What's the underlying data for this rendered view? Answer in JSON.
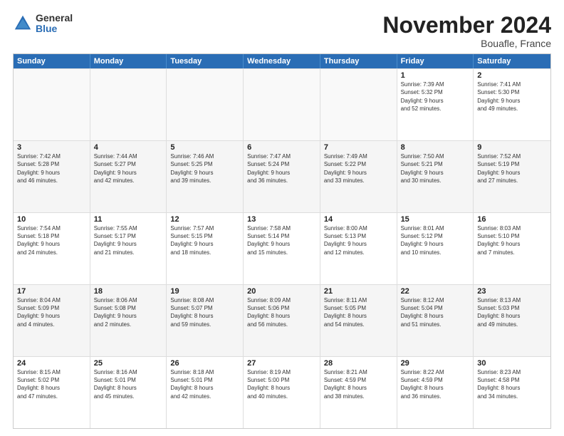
{
  "logo": {
    "general": "General",
    "blue": "Blue"
  },
  "header": {
    "month": "November 2024",
    "location": "Bouafle, France"
  },
  "days": [
    "Sunday",
    "Monday",
    "Tuesday",
    "Wednesday",
    "Thursday",
    "Friday",
    "Saturday"
  ],
  "weeks": [
    [
      {
        "day": "",
        "info": ""
      },
      {
        "day": "",
        "info": ""
      },
      {
        "day": "",
        "info": ""
      },
      {
        "day": "",
        "info": ""
      },
      {
        "day": "",
        "info": ""
      },
      {
        "day": "1",
        "info": "Sunrise: 7:39 AM\nSunset: 5:32 PM\nDaylight: 9 hours\nand 52 minutes."
      },
      {
        "day": "2",
        "info": "Sunrise: 7:41 AM\nSunset: 5:30 PM\nDaylight: 9 hours\nand 49 minutes."
      }
    ],
    [
      {
        "day": "3",
        "info": "Sunrise: 7:42 AM\nSunset: 5:28 PM\nDaylight: 9 hours\nand 46 minutes."
      },
      {
        "day": "4",
        "info": "Sunrise: 7:44 AM\nSunset: 5:27 PM\nDaylight: 9 hours\nand 42 minutes."
      },
      {
        "day": "5",
        "info": "Sunrise: 7:46 AM\nSunset: 5:25 PM\nDaylight: 9 hours\nand 39 minutes."
      },
      {
        "day": "6",
        "info": "Sunrise: 7:47 AM\nSunset: 5:24 PM\nDaylight: 9 hours\nand 36 minutes."
      },
      {
        "day": "7",
        "info": "Sunrise: 7:49 AM\nSunset: 5:22 PM\nDaylight: 9 hours\nand 33 minutes."
      },
      {
        "day": "8",
        "info": "Sunrise: 7:50 AM\nSunset: 5:21 PM\nDaylight: 9 hours\nand 30 minutes."
      },
      {
        "day": "9",
        "info": "Sunrise: 7:52 AM\nSunset: 5:19 PM\nDaylight: 9 hours\nand 27 minutes."
      }
    ],
    [
      {
        "day": "10",
        "info": "Sunrise: 7:54 AM\nSunset: 5:18 PM\nDaylight: 9 hours\nand 24 minutes."
      },
      {
        "day": "11",
        "info": "Sunrise: 7:55 AM\nSunset: 5:17 PM\nDaylight: 9 hours\nand 21 minutes."
      },
      {
        "day": "12",
        "info": "Sunrise: 7:57 AM\nSunset: 5:15 PM\nDaylight: 9 hours\nand 18 minutes."
      },
      {
        "day": "13",
        "info": "Sunrise: 7:58 AM\nSunset: 5:14 PM\nDaylight: 9 hours\nand 15 minutes."
      },
      {
        "day": "14",
        "info": "Sunrise: 8:00 AM\nSunset: 5:13 PM\nDaylight: 9 hours\nand 12 minutes."
      },
      {
        "day": "15",
        "info": "Sunrise: 8:01 AM\nSunset: 5:12 PM\nDaylight: 9 hours\nand 10 minutes."
      },
      {
        "day": "16",
        "info": "Sunrise: 8:03 AM\nSunset: 5:10 PM\nDaylight: 9 hours\nand 7 minutes."
      }
    ],
    [
      {
        "day": "17",
        "info": "Sunrise: 8:04 AM\nSunset: 5:09 PM\nDaylight: 9 hours\nand 4 minutes."
      },
      {
        "day": "18",
        "info": "Sunrise: 8:06 AM\nSunset: 5:08 PM\nDaylight: 9 hours\nand 2 minutes."
      },
      {
        "day": "19",
        "info": "Sunrise: 8:08 AM\nSunset: 5:07 PM\nDaylight: 8 hours\nand 59 minutes."
      },
      {
        "day": "20",
        "info": "Sunrise: 8:09 AM\nSunset: 5:06 PM\nDaylight: 8 hours\nand 56 minutes."
      },
      {
        "day": "21",
        "info": "Sunrise: 8:11 AM\nSunset: 5:05 PM\nDaylight: 8 hours\nand 54 minutes."
      },
      {
        "day": "22",
        "info": "Sunrise: 8:12 AM\nSunset: 5:04 PM\nDaylight: 8 hours\nand 51 minutes."
      },
      {
        "day": "23",
        "info": "Sunrise: 8:13 AM\nSunset: 5:03 PM\nDaylight: 8 hours\nand 49 minutes."
      }
    ],
    [
      {
        "day": "24",
        "info": "Sunrise: 8:15 AM\nSunset: 5:02 PM\nDaylight: 8 hours\nand 47 minutes."
      },
      {
        "day": "25",
        "info": "Sunrise: 8:16 AM\nSunset: 5:01 PM\nDaylight: 8 hours\nand 45 minutes."
      },
      {
        "day": "26",
        "info": "Sunrise: 8:18 AM\nSunset: 5:01 PM\nDaylight: 8 hours\nand 42 minutes."
      },
      {
        "day": "27",
        "info": "Sunrise: 8:19 AM\nSunset: 5:00 PM\nDaylight: 8 hours\nand 40 minutes."
      },
      {
        "day": "28",
        "info": "Sunrise: 8:21 AM\nSunset: 4:59 PM\nDaylight: 8 hours\nand 38 minutes."
      },
      {
        "day": "29",
        "info": "Sunrise: 8:22 AM\nSunset: 4:59 PM\nDaylight: 8 hours\nand 36 minutes."
      },
      {
        "day": "30",
        "info": "Sunrise: 8:23 AM\nSunset: 4:58 PM\nDaylight: 8 hours\nand 34 minutes."
      }
    ]
  ]
}
